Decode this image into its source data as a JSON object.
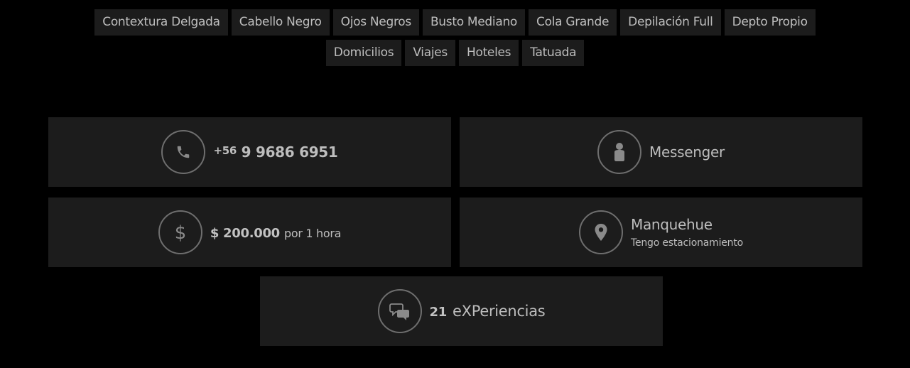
{
  "tags": {
    "row1": [
      "Contextura Delgada",
      "Cabello Negro",
      "Ojos Negros",
      "Busto Mediano",
      "Cola Grande",
      "Depilación Full",
      "Depto Propio"
    ],
    "row2": [
      "Domicilios",
      "Viajes",
      "Hoteles",
      "Tatuada"
    ]
  },
  "contact": {
    "phone_prefix": "+56",
    "phone_number": "9 9686 6951",
    "messenger_label": "Messenger"
  },
  "price": {
    "amount": "$ 200.000",
    "unit": "por 1 hora"
  },
  "location": {
    "area": "Manquehue",
    "note": "Tengo estacionamiento"
  },
  "experiences": {
    "count": "21",
    "label": "eXPeriencias"
  },
  "colors": {
    "background": "#000000",
    "card": "#1c1c1c",
    "text": "#bdbdbd",
    "icon_ring": "#6e6e6e"
  },
  "icons": {
    "phone": "phone-icon",
    "messenger": "person-icon",
    "price": "dollar-icon",
    "location": "map-pin-icon",
    "experiences": "chat-bubbles-icon"
  }
}
